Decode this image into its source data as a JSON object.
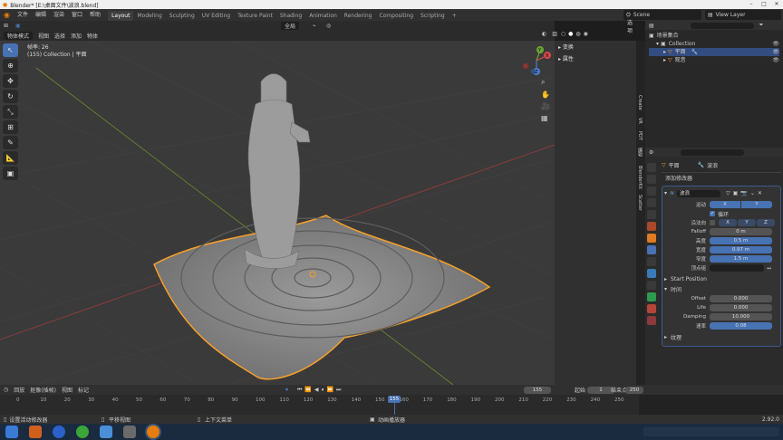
{
  "titlebar": {
    "title": "Blender* [E:\\桌面文件\\波浪.blend]"
  },
  "topbar": {
    "menus": [
      "文件",
      "编辑",
      "渲染",
      "窗口",
      "帮助"
    ],
    "workspaces": [
      "Layout",
      "Modeling",
      "Sculpting",
      "UV Editing",
      "Texture Paint",
      "Shading",
      "Animation",
      "Rendering",
      "Compositing",
      "Scripting"
    ],
    "add_tab": "+",
    "scene_label": "Scene",
    "viewlayer_label": "View Layer"
  },
  "viewport_header": {
    "mode": "物体模式",
    "menus": [
      "视图",
      "选择",
      "添加",
      "物体"
    ],
    "transform": "全局",
    "options": "选项"
  },
  "viewport": {
    "view_name": "帧率: 26",
    "collection_info": "(155) Collection | 平面",
    "gizmo_labels": {
      "x": "X",
      "y": "Y",
      "z": "Z"
    }
  },
  "side_tabs": [
    "变换",
    "属性"
  ],
  "ntabs": [
    "Create",
    "VR",
    "PDT",
    "编辑",
    "BlenderKit",
    "Scatter"
  ],
  "outliner": {
    "root": "场景集合",
    "collection": "Collection",
    "items": [
      "平面",
      "观音"
    ]
  },
  "properties": {
    "object_name": "平面",
    "modifier_tab": "波浪",
    "add_modifier": "添加修改器",
    "modifier_name": "波浪",
    "motion_label": "运动",
    "motion_x": "X",
    "motion_y": "Y",
    "cyclic_label": "循环",
    "along_normals_label": "沿法向",
    "normal_axes": [
      "X",
      "Y",
      "Z"
    ],
    "falloff_label": "Falloff",
    "falloff_value": "0 m",
    "height_label": "高度",
    "height_value": "0.5 m",
    "width_label": "宽度",
    "width_value": "0.97 m",
    "narrowness_label": "窄度",
    "narrowness_value": "1.5 m",
    "vertex_group_label": "顶点组",
    "start_position": "Start Position",
    "time_section": "时间",
    "offset_label": "Offset",
    "offset_value": "0.000",
    "life_label": "Life",
    "life_value": "0.000",
    "damping_label": "Damping",
    "damping_value": "10.000",
    "speed_label": "速率",
    "speed_value": "0.08",
    "texture_section": "纹理"
  },
  "timeline": {
    "playback": "回放",
    "keying": "抠像(插帧)",
    "view": "视图",
    "marker": "标记",
    "current_frame": "155",
    "start_label": "起始",
    "start_value": "1",
    "end_label": "结束点",
    "end_value": "250",
    "ticks": [
      "0",
      "10",
      "20",
      "30",
      "40",
      "50",
      "60",
      "70",
      "80",
      "90",
      "100",
      "110",
      "120",
      "130",
      "140",
      "150",
      "160",
      "170",
      "180",
      "190",
      "200",
      "210",
      "220",
      "230",
      "240",
      "250"
    ],
    "playhead": "155"
  },
  "statusbar": {
    "left": "设置活动修改器",
    "middle": "平移视图",
    "center": "上下文菜单",
    "anim": "动画播放器",
    "version": "2.92.0"
  },
  "colors": {
    "accent": "#4772b3",
    "select_orange": "#f5a02a",
    "playhead": "#4772b3"
  }
}
